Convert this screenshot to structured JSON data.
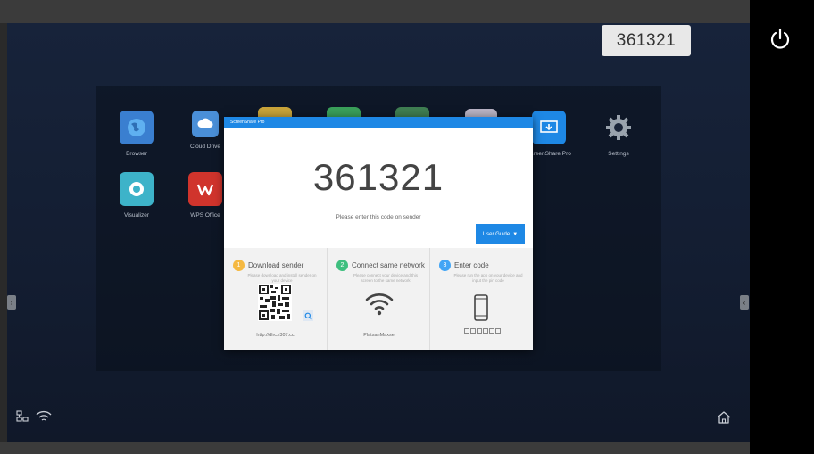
{
  "header": {
    "code": "361321"
  },
  "apps": [
    {
      "label": "Browser",
      "icon": "globe-icon"
    },
    {
      "label": "Cloud Drive",
      "icon": "cloud-icon"
    },
    {
      "label": "ScreenShare Pro",
      "icon": "screenshare-icon"
    },
    {
      "label": "Settings",
      "icon": "gear-icon"
    },
    {
      "label": "Visualizer",
      "icon": "camera-icon"
    },
    {
      "label": "WPS Office",
      "icon": "wps-icon"
    }
  ],
  "dialog": {
    "title": "ScreenShare Pro",
    "code": "361321",
    "hint": "Please enter this code on sender",
    "guide_label": "User Guide",
    "steps": [
      {
        "num": "1",
        "title": "Download sender",
        "desc": "Please download and install sender on your device",
        "footer": "http://dlrc.r307.cc",
        "color": "#f5b942"
      },
      {
        "num": "2",
        "title": "Connect same network",
        "desc": "Please connect your device and this screen to the same network",
        "footer": "PlatsanMaxse",
        "color": "#3fbf7f"
      },
      {
        "num": "3",
        "title": "Enter code",
        "desc": "Please run the app on your device and input the pin code",
        "footer": "",
        "color": "#42a5f5"
      }
    ]
  },
  "colors": {
    "accent": "#1e88e5",
    "desktop_bg": "#131d31"
  }
}
